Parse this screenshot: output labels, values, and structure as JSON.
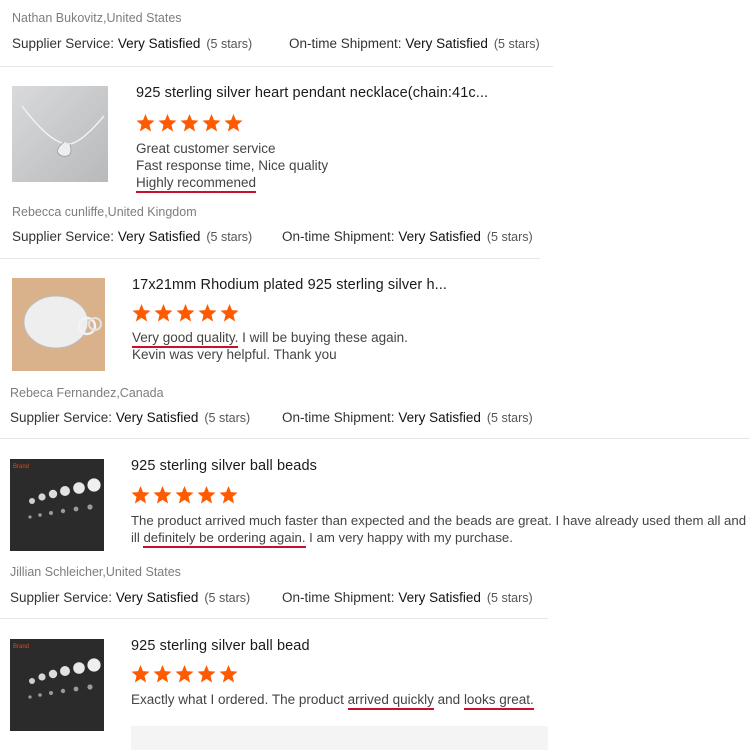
{
  "colors": {
    "star": "#ff5a00",
    "underline": "#c8102e",
    "divider": "#e6e6e6"
  },
  "labels": {
    "supplier_service": "Supplier Service:",
    "ontime_shipment": "On-time Shipment:",
    "rating_word": "Very Satisfied",
    "stars_text": "(5 stars)"
  },
  "reviews": [
    {
      "reviewer": "Nathan Bukovitz,United States"
    },
    {
      "title": "925 sterling silver heart pendant necklace(chain:41c...",
      "stars": 5,
      "thumb_icon": "pendant-necklace-photo",
      "lines": [
        "Great customer service",
        "Fast response time, Nice quality",
        "Highly recommened"
      ],
      "reviewer": "Rebecca cunliffe,United Kingdom"
    },
    {
      "title": "17x21mm Rhodium plated 925 sterling silver h...",
      "stars": 5,
      "thumb_icon": "silver-tag-photo",
      "line1_u": "Very good quality.",
      "line1_rest": " I will be buying these again.",
      "line2": "Kevin was very helpful. Thank you",
      "reviewer": "Rebeca Fernandez,Canada"
    },
    {
      "title": "925 sterling silver ball beads",
      "stars": 5,
      "thumb_icon": "ball-beads-photo",
      "line1": "The product arrived much faster than expected and the beads are great. I have already used them all and w",
      "line2_pre": "ill ",
      "line2_u": "definitely be ordering again.",
      "line2_post": " I am very happy with my purchase.",
      "reviewer": "Jillian Schleicher,United States"
    },
    {
      "title": "925 sterling silver ball bead",
      "stars": 5,
      "thumb_icon": "ball-beads-photo",
      "pre": "Exactly what I ordered. The product ",
      "u1": "arrived quickly",
      "mid": " and ",
      "u2": "looks great."
    }
  ]
}
